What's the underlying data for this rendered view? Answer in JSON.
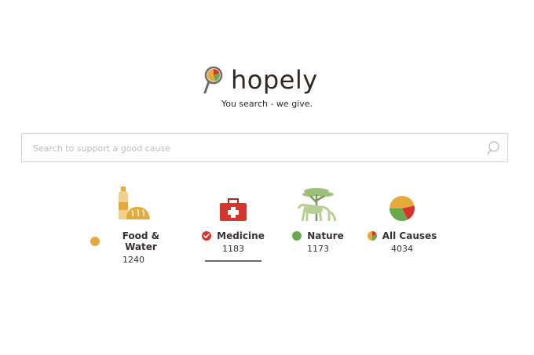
{
  "brand": {
    "name": "hopely",
    "tagline": "You search - we give."
  },
  "search": {
    "placeholder": "Search to support a good cause",
    "value": ""
  },
  "causes": [
    {
      "label": "Food & Water",
      "count": "1240",
      "icon": "bread-bottle-icon",
      "dot_color": "#e8a93b",
      "selected": false
    },
    {
      "label": "Medicine",
      "count": "1183",
      "icon": "first-aid-kit-icon",
      "dot_color": "#d9342b",
      "selected": true
    },
    {
      "label": "Nature",
      "count": "1173",
      "icon": "cheetah-tree-icon",
      "dot_color": "#6aa84f",
      "selected": false
    },
    {
      "label": "All Causes",
      "count": "4034",
      "icon": "pie-icon",
      "dot_color": "multi",
      "selected": false
    }
  ],
  "colors": {
    "yellow": "#e8a93b",
    "red": "#d9342b",
    "green": "#6aa84f",
    "text": "#3a3030"
  }
}
